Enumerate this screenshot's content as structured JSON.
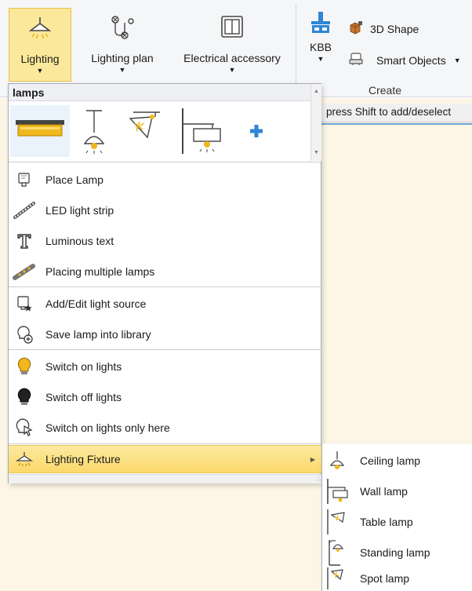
{
  "ribbon": {
    "buttons": [
      {
        "label": "Lighting",
        "icon": "ceiling-lamp-icon"
      },
      {
        "label": "Lighting plan",
        "icon": "lighting-plan-icon"
      },
      {
        "label": "Electrical accessory",
        "icon": "electrical-socket-icon"
      }
    ],
    "create_group": {
      "threed_shape": "3D Shape",
      "kbb": "KBB",
      "smart_objects": "Smart Objects",
      "group_label": "Create"
    }
  },
  "hint": "press Shift to add/deselect",
  "dropdown": {
    "header": "lamps",
    "gallery_icons": [
      "flat-ceiling-lamp-icon",
      "pendant-lamp-icon",
      "spot-lamp-icon",
      "wall-lamp-icon",
      "add-icon"
    ],
    "menu": [
      {
        "label": "Place Lamp",
        "icon": "place-lamp-icon"
      },
      {
        "label": "LED light strip",
        "icon": "led-strip-icon"
      },
      {
        "label": "Luminous text",
        "icon": "luminous-text-icon"
      },
      {
        "label": "Placing multiple lamps",
        "icon": "multiple-lamps-icon"
      },
      {
        "label": "Add/Edit light source",
        "icon": "light-source-icon"
      },
      {
        "label": "Save lamp into library",
        "icon": "save-lamp-icon"
      },
      {
        "label": "Switch on lights",
        "icon": "bulb-on-icon"
      },
      {
        "label": "Switch off lights",
        "icon": "bulb-off-icon"
      },
      {
        "label": "Switch on lights only here",
        "icon": "bulb-cursor-icon"
      },
      {
        "label": "Lighting Fixture",
        "icon": "ceiling-lamp-icon"
      }
    ]
  },
  "submenu": [
    {
      "label": "Ceiling lamp",
      "icon": "ceiling-lamp-icon"
    },
    {
      "label": "Wall lamp",
      "icon": "wall-lamp-icon"
    },
    {
      "label": "Table lamp",
      "icon": "table-lamp-icon"
    },
    {
      "label": "Standing lamp",
      "icon": "standing-lamp-icon"
    },
    {
      "label": "Spot lamp",
      "icon": "spot-lamp-icon"
    }
  ],
  "colors": {
    "active": "#fce89b",
    "highlight": "#fbd86a",
    "workspace": "#fdf6e6",
    "accent": "#2e86d4",
    "bulb": "#f0b81c"
  }
}
